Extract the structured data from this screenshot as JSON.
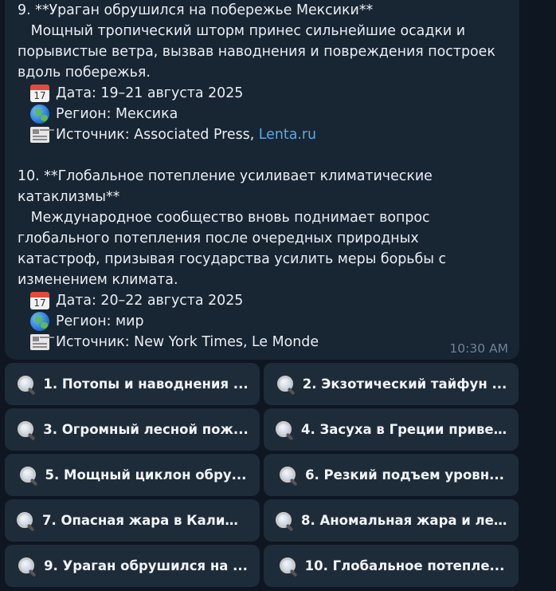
{
  "message": {
    "item9": {
      "title": "9. **Ураган обрушился на побережье Мексики**",
      "body": [
        "   Мощный тропический шторм принес сильнейшие осадки и",
        "порывистые ветра, вызвав наводнения и повреждения построек",
        "вдоль побережья."
      ],
      "date": "Дата: 19–21 августа 2025",
      "region": "Регион: Мексика",
      "source_prefix": "Источник: Associated Press, ",
      "source_link": "Lenta.ru"
    },
    "item10": {
      "title_line1": "10. **Глобальное потепление усиливает климатические",
      "title_line2": "катаклизмы**",
      "body": [
        "   Международное сообщество вновь поднимает вопрос",
        "глобального потепления после очередных природных",
        "катастроф, призывая государства усилить меры борьбы с",
        "изменением климата."
      ],
      "date": "Дата: 20–22 августа 2025",
      "region": "Регион: мир",
      "source": "Источник: New York Times, Le Monde"
    },
    "time": "10:30 AM"
  },
  "icons": {
    "date": "calendar-icon",
    "region": "globe-icon",
    "source": "newspaper-icon",
    "button": "magnifier-icon"
  },
  "buttons": [
    "1. Потопы и наводнения ...",
    "2. Экзотический тайфун ...",
    "3. Огромный лесной пож...",
    "4. Засуха в Греции приве...",
    "5. Мощный циклон обру...",
    "6. Резкий подъем уровн...",
    "7. Опасная жара в Калиф...",
    "8. Аномальная жара и ле...",
    "9. Ураган обрушился на ...",
    "10. Глобальное потепле..."
  ],
  "colors": {
    "background": "#0e1621",
    "bubble": "#182533",
    "button": "#1e2c3a",
    "link": "#5fa8e6",
    "timestamp": "#6d8397"
  }
}
